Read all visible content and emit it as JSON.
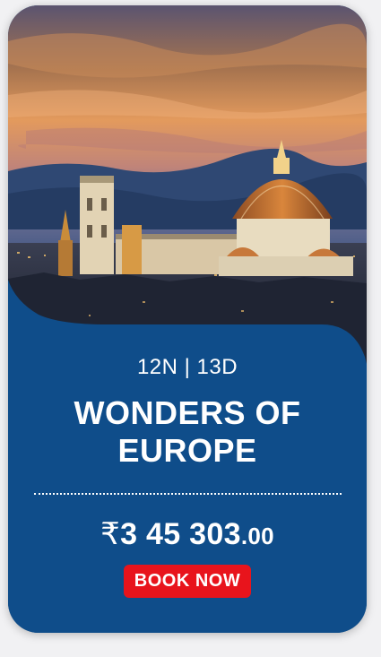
{
  "package": {
    "duration": "12N | 13D",
    "title": "WONDERS OF EUROPE",
    "price_currency": "₹",
    "price_main": "3 45 303",
    "price_decimal": ".00",
    "book_label": "BOOK NOW"
  },
  "colors": {
    "panel": "#0f4d8a",
    "button": "#e8141c",
    "background": "#f1f1f3"
  }
}
